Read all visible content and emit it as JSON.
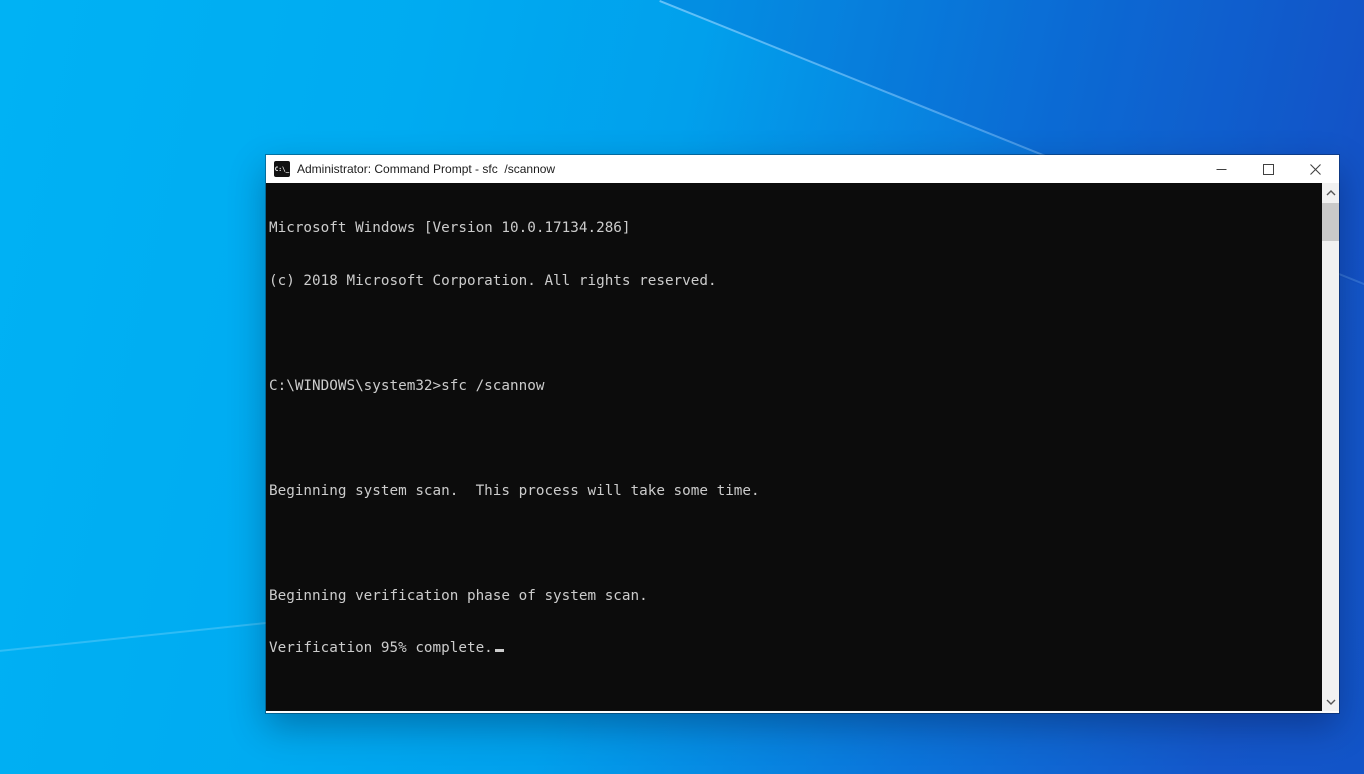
{
  "window": {
    "title": "Administrator: Command Prompt - sfc  /scannow",
    "icon_glyph": "C:\\_"
  },
  "console": {
    "lines": [
      "Microsoft Windows [Version 10.0.17134.286]",
      "(c) 2018 Microsoft Corporation. All rights reserved.",
      "",
      "C:\\WINDOWS\\system32>sfc /scannow",
      "",
      "Beginning system scan.  This process will take some time.",
      "",
      "Beginning verification phase of system scan.",
      "Verification 95% complete."
    ]
  },
  "colors": {
    "desktop_bright": "#00b2f4",
    "desktop_dark": "#1254c8",
    "titlebar_background": "#ffffff",
    "console_background": "#0c0c0c",
    "console_text": "#cccccc",
    "scrollbar_track": "#f1f1f1",
    "scrollbar_thumb": "#c9c9c9"
  }
}
